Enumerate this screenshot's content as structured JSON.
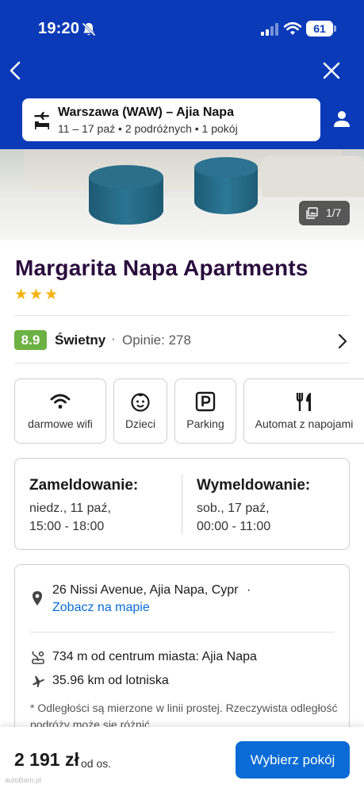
{
  "status_bar": {
    "time": "19:20",
    "battery": "61"
  },
  "search": {
    "route": "Warszawa (WAW) – Ajia Napa",
    "details": "11 – 17 paź • 2 podróżnych • 1 pokój"
  },
  "gallery": {
    "counter": "1/7"
  },
  "hotel": {
    "name": "Margarita Napa Apartments",
    "stars": "★★★",
    "star_count": 3
  },
  "rating": {
    "score": "8.9",
    "label": "Świetny",
    "separator": "·",
    "reviews": "Opinie: 278"
  },
  "amenities": [
    {
      "label": "darmowe wifi",
      "icon": "wifi-icon"
    },
    {
      "label": "Dzieci",
      "icon": "child-face-icon"
    },
    {
      "label": "Parking",
      "icon": "parking-icon"
    },
    {
      "label": "Automat z napojami",
      "icon": "fork-knife-icon"
    }
  ],
  "checkin": {
    "in_label": "Zameldowanie:",
    "in_date": "niedz., 11 paź,",
    "in_time": "15:00 - 18:00",
    "out_label": "Wymeldowanie:",
    "out_date": "sob., 17 paź,",
    "out_time": "00:00 - 11:00"
  },
  "location": {
    "address": "26 Nissi Avenue, Ajia Napa, Cypr",
    "map_link": "Zobacz na mapie",
    "separator": "·",
    "center_distance": "734 m od centrum miasta: Ajia Napa",
    "airport_distance": "35.96 km od lotniska",
    "note": "* Odległości są mierzone w linii prostej. Rzeczywista odległość podróży może się różnić."
  },
  "footer": {
    "price": "2 191 zł",
    "per": "od os.",
    "select_label": "Wybierz pokój"
  },
  "watermark": "autoBarn.pl",
  "colors": {
    "header_blue": "#0a3ab8",
    "link_blue": "#0a6bd6",
    "rating_green": "#6cb143",
    "star_yellow": "#f6b20b",
    "title_purple": "#2a0c3d"
  }
}
